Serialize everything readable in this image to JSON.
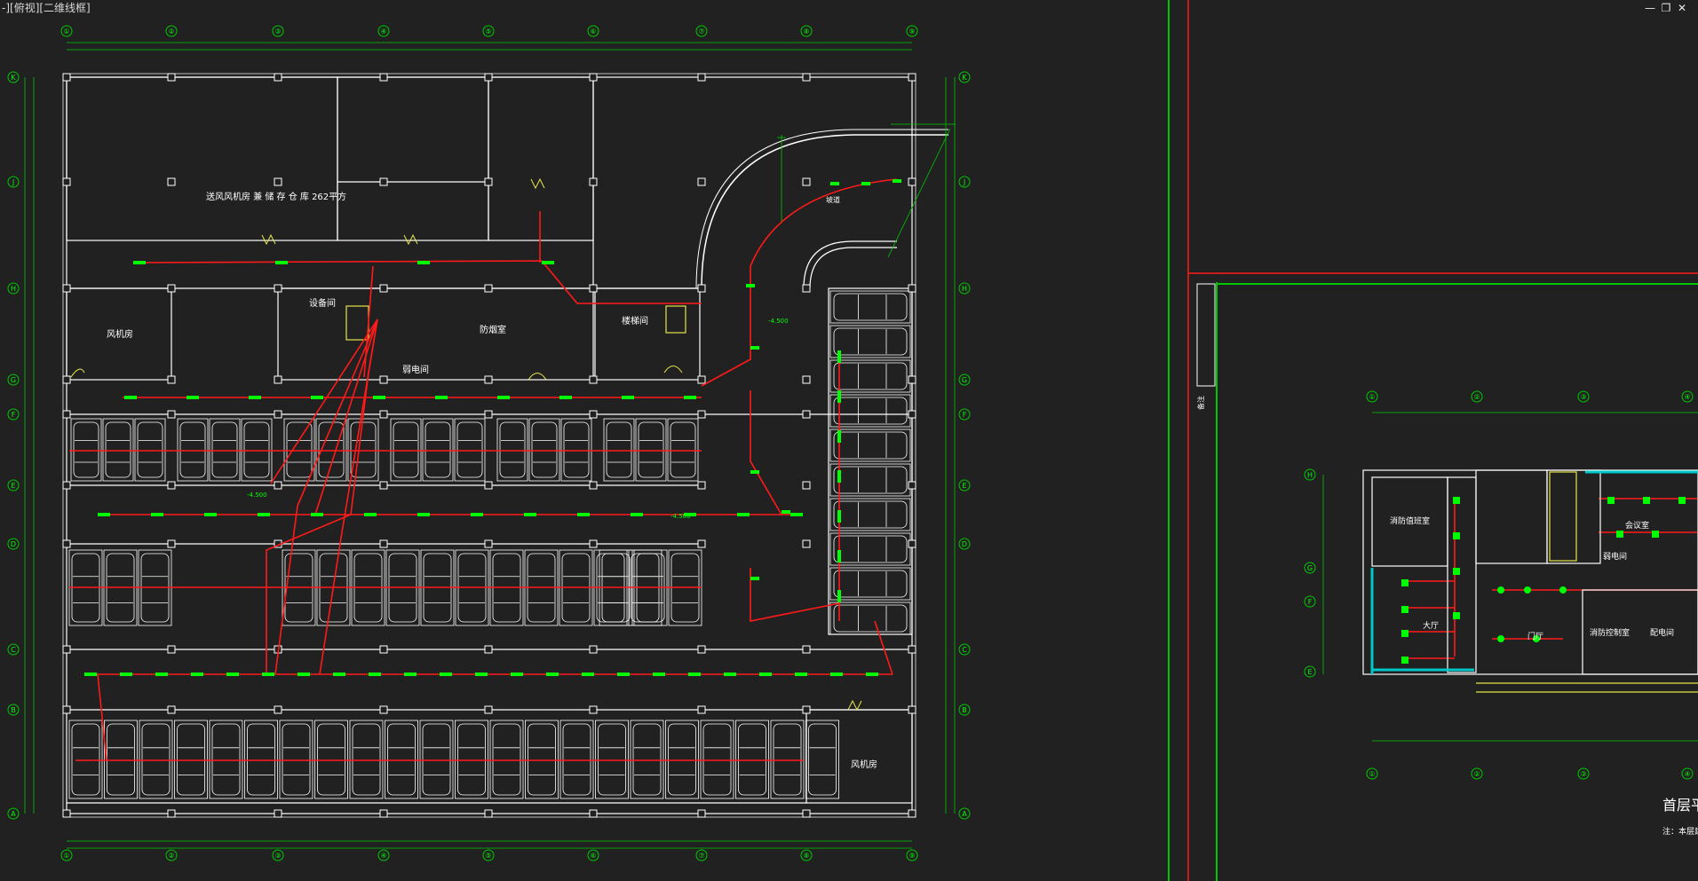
{
  "window": {
    "viewport_label": "-][俯视][二维线框]",
    "minimize_icon": "minimize-icon",
    "restore_icon": "restore-icon",
    "close_icon": "close-icon"
  },
  "colors": {
    "background": "#212121",
    "wall": "#ffffff",
    "dimension": "#00c800",
    "wiring": "#ff1a1a",
    "fixture": "#00ff00",
    "highlight_cyan": "#00c8c8",
    "highlight_yellow": "#e6e64b"
  },
  "basement_plan": {
    "grid_top": [
      "①",
      "②",
      "③",
      "④",
      "⑤",
      "⑥",
      "⑦",
      "⑧",
      "⑨"
    ],
    "grid_bottom": [
      "①",
      "②",
      "③",
      "④",
      "⑤",
      "⑥",
      "⑦",
      "⑧",
      "⑨"
    ],
    "grid_left": [
      "K",
      "J",
      "H",
      "G",
      "F",
      "E",
      "D",
      "C",
      "B",
      "A"
    ],
    "grid_right": [
      "K",
      "J",
      "H",
      "G",
      "F",
      "E",
      "D",
      "C",
      "B",
      "A"
    ],
    "rooms": {
      "big_room": "送风风机房 兼 储 存 仓 库 262平方",
      "fan_room_left": "风机房",
      "fan_room_bottom": "风机房",
      "stair_room": "楼梯间",
      "corridor": "防烟室",
      "electric_room": "弱电间",
      "equipment_room": "设备间"
    },
    "elevation_1": "-4.500",
    "elevation_2": "-4.500",
    "elevation_3": "-4.500",
    "ramp_label": "坡道"
  },
  "sheet": {
    "vertical_note": "备注",
    "ground_grid": [
      "①",
      "②",
      "③",
      "④"
    ],
    "ground_grid_bottom": [
      "①",
      "②",
      "③",
      "④"
    ],
    "ground_grid_left": [
      "H",
      "G",
      "F",
      "E"
    ],
    "rooms": {
      "duty_room": "消防值班室",
      "lobby": "门厅",
      "hall": "大厅",
      "meeting": "会议室",
      "electric": "弱电间",
      "office": "配电间",
      "security": "消防控制室"
    },
    "title": "首层平",
    "note": "注：本层建筑"
  }
}
